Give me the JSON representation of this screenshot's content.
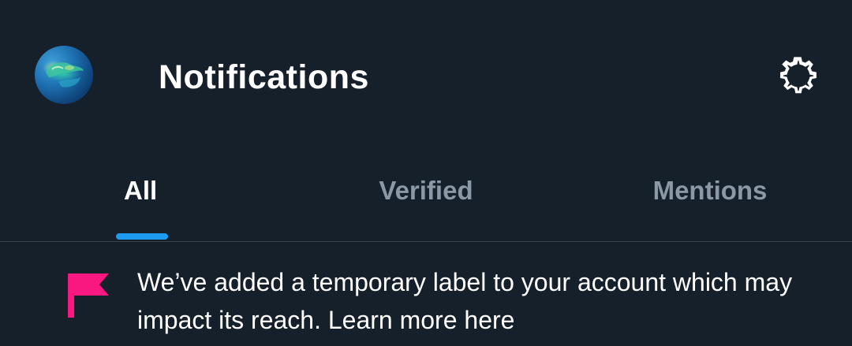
{
  "header": {
    "title": "Notifications",
    "avatar_icon": "globe-avatar",
    "settings_icon": "gear-icon"
  },
  "tabs": [
    {
      "label": "All",
      "active": true
    },
    {
      "label": "Verified",
      "active": false
    },
    {
      "label": "Mentions",
      "active": false
    }
  ],
  "notice": {
    "icon": "flag-icon",
    "text": "We’ve added a temporary label to your account which may impact its reach. Learn more here"
  },
  "colors": {
    "background": "#15202b",
    "accent": "#1d9bf0",
    "flag": "#f91880",
    "inactive_tab": "#8b98a5",
    "divider": "#38444d"
  }
}
